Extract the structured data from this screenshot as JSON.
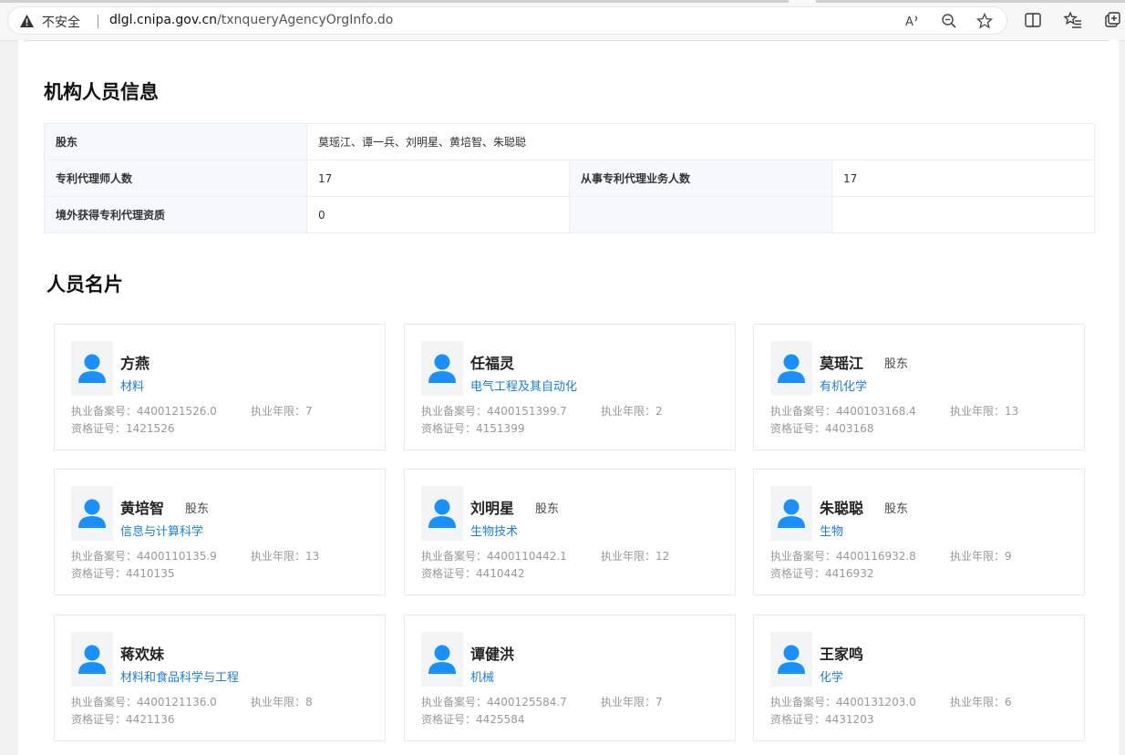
{
  "browser": {
    "insecure_label": "不安全",
    "url_host": "dlgl.cnipa.gov.cn",
    "url_path": "/txnqueryAgencyOrgInfo.do"
  },
  "section1": {
    "title": "机构人员信息",
    "shareholders_label": "股东",
    "shareholders_value": "莫瑶江、谭一兵、刘明星、黄培智、朱聪聪",
    "agents_label": "专利代理师人数",
    "agents_value": "17",
    "staff_label": "从事专利代理业务人数",
    "staff_value": "17",
    "overseas_label": "境外获得专利代理资质",
    "overseas_value": "0"
  },
  "section2": {
    "title": "人员名片",
    "record_label": "执业备案号：",
    "years_label": "执业年限：",
    "cert_label": "资格证号：",
    "cards": [
      {
        "name": "方燕",
        "role": "",
        "field": "材料",
        "record": "4400121526.0",
        "years": "7",
        "cert": "1421526"
      },
      {
        "name": "任福灵",
        "role": "",
        "field": "电气工程及其自动化",
        "record": "4400151399.7",
        "years": "2",
        "cert": "4151399"
      },
      {
        "name": "莫瑶江",
        "role": "股东",
        "field": "有机化学",
        "record": "4400103168.4",
        "years": "13",
        "cert": "4403168"
      },
      {
        "name": "黄培智",
        "role": "股东",
        "field": "信息与计算科学",
        "record": "4400110135.9",
        "years": "13",
        "cert": "4410135"
      },
      {
        "name": "刘明星",
        "role": "股东",
        "field": "生物技术",
        "record": "4400110442.1",
        "years": "12",
        "cert": "4410442"
      },
      {
        "name": "朱聪聪",
        "role": "股东",
        "field": "生物",
        "record": "4400116932.8",
        "years": "9",
        "cert": "4416932"
      },
      {
        "name": "蒋欢妹",
        "role": "",
        "field": "材料和食品科学与工程",
        "record": "4400121136.0",
        "years": "8",
        "cert": "4421136"
      },
      {
        "name": "谭健洪",
        "role": "",
        "field": "机械",
        "record": "4400125584.7",
        "years": "7",
        "cert": "4425584"
      },
      {
        "name": "王家鸣",
        "role": "",
        "field": "化学",
        "record": "4400131203.0",
        "years": "6",
        "cert": "4431203"
      }
    ]
  }
}
